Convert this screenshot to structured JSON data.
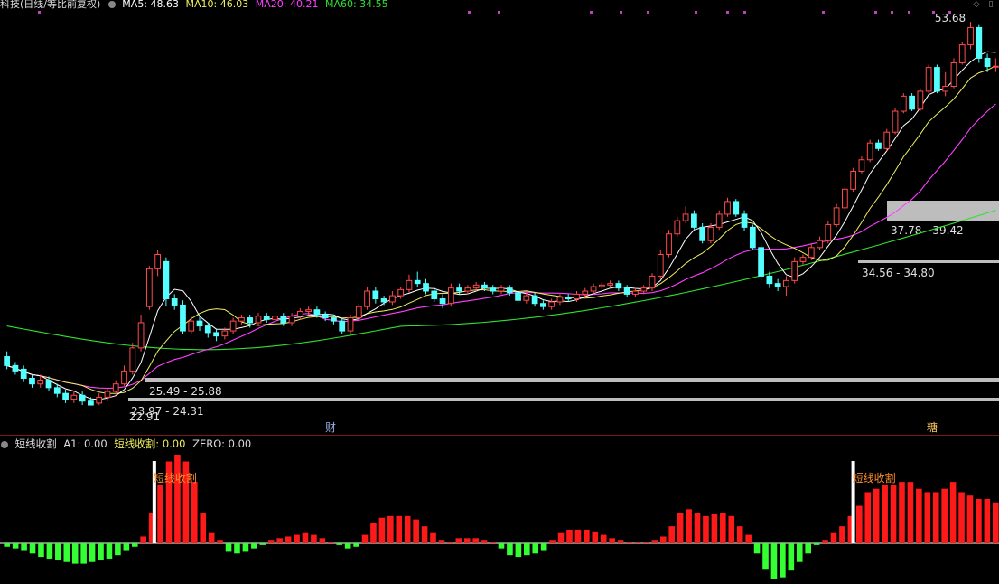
{
  "header": {
    "title": "科技(日线/等比前复权)",
    "ma5_label": "MA5: 48.63",
    "ma10_label": "MA10: 46.03",
    "ma20_label": "MA20: 40.21",
    "ma60_label": "MA60: 34.55"
  },
  "indicator_header": {
    "name": "短线收割",
    "a1_label": "A1: 0.00",
    "signal_label": "短线收割: 0.00",
    "zero_label": "ZERO: 0.00"
  },
  "markers": {
    "cai": "财",
    "tang": "糖"
  },
  "colors": {
    "up": "#ff4a4a",
    "down": "#54ffff",
    "ma5": "#ffffff",
    "ma10": "#f0f060",
    "ma20": "#ff40ff",
    "ma60": "#30e030",
    "pos_bar": "#ff1a1a",
    "neg_bar": "#33ff33",
    "signal_text": "#ff8c2a",
    "zone": "#bdbdbd"
  },
  "chart_data": [
    {
      "type": "candlestick",
      "title": "科技(日线/等比前复权)",
      "y_range": [
        22,
        55
      ],
      "high_label": "53.68",
      "low_label": "22.91",
      "zones": [
        {
          "label": "25.49 - 25.88",
          "low": 25.49,
          "high": 25.88
        },
        {
          "label": "23.97 - 24.31",
          "low": 23.97,
          "high": 24.31
        },
        {
          "label": "37.78 - 39.42",
          "low": 37.78,
          "high": 39.42
        },
        {
          "label": "34.56 - 34.80",
          "low": 34.56,
          "high": 34.8
        }
      ],
      "candles": [
        [
          25.5,
          25.0,
          25.8,
          24.8
        ],
        [
          25.0,
          24.7,
          25.2,
          24.5
        ],
        [
          24.8,
          24.3,
          25.0,
          24.1
        ],
        [
          24.3,
          24.0,
          24.5,
          23.8
        ],
        [
          24.0,
          24.2,
          24.5,
          23.8
        ],
        [
          24.2,
          23.8,
          24.4,
          23.6
        ],
        [
          23.8,
          23.5,
          24.0,
          23.3
        ],
        [
          23.5,
          23.2,
          23.7,
          23.0
        ],
        [
          23.2,
          23.4,
          23.6,
          23.0
        ],
        [
          23.4,
          23.1,
          23.6,
          22.9
        ],
        [
          23.1,
          22.9,
          23.3,
          22.91
        ],
        [
          23.0,
          23.3,
          23.5,
          22.9
        ],
        [
          23.3,
          23.6,
          23.8,
          23.1
        ],
        [
          23.6,
          24.0,
          24.2,
          23.4
        ],
        [
          24.0,
          24.7,
          25.0,
          23.9
        ],
        [
          24.7,
          26.0,
          26.3,
          24.5
        ],
        [
          26.0,
          27.5,
          28.0,
          25.8
        ],
        [
          28.5,
          31.0,
          31.2,
          28.3
        ],
        [
          31.0,
          32.0,
          32.3,
          30.5
        ],
        [
          31.5,
          29.0,
          31.8,
          28.5
        ],
        [
          29.0,
          28.6,
          29.3,
          28.3
        ],
        [
          28.6,
          27.0,
          28.9,
          26.8
        ],
        [
          27.0,
          27.6,
          27.9,
          26.8
        ],
        [
          27.6,
          27.3,
          27.9,
          27.0
        ],
        [
          27.3,
          26.9,
          27.5,
          26.6
        ],
        [
          26.9,
          26.7,
          27.1,
          26.4
        ],
        [
          26.7,
          27.0,
          27.2,
          26.5
        ],
        [
          27.0,
          27.6,
          27.8,
          26.8
        ],
        [
          27.6,
          27.8,
          28.0,
          27.4
        ],
        [
          27.8,
          27.5,
          28.0,
          27.2
        ],
        [
          27.5,
          27.9,
          28.1,
          27.3
        ],
        [
          27.9,
          27.7,
          28.1,
          27.5
        ],
        [
          27.7,
          27.9,
          28.1,
          27.5
        ],
        [
          27.9,
          27.5,
          28.1,
          27.3
        ],
        [
          27.5,
          27.9,
          28.1,
          27.3
        ],
        [
          27.9,
          28.2,
          28.4,
          27.7
        ],
        [
          28.2,
          28.3,
          28.5,
          28.0
        ],
        [
          28.3,
          28.0,
          28.5,
          27.8
        ],
        [
          28.0,
          27.8,
          28.2,
          27.6
        ],
        [
          27.8,
          27.6,
          28.0,
          27.4
        ],
        [
          27.6,
          27.0,
          27.8,
          26.8
        ],
        [
          27.0,
          27.8,
          28.0,
          26.8
        ],
        [
          27.8,
          28.5,
          28.7,
          27.6
        ],
        [
          28.5,
          29.5,
          29.8,
          28.3
        ],
        [
          29.5,
          29.0,
          29.8,
          28.7
        ],
        [
          29.0,
          28.8,
          29.2,
          28.6
        ],
        [
          28.8,
          29.2,
          29.5,
          28.6
        ],
        [
          29.2,
          29.6,
          29.8,
          29.0
        ],
        [
          29.6,
          30.2,
          30.6,
          29.4
        ],
        [
          30.2,
          30.0,
          30.8,
          29.8
        ],
        [
          30.0,
          29.5,
          30.3,
          29.3
        ],
        [
          29.5,
          29.0,
          29.8,
          28.8
        ],
        [
          29.0,
          28.7,
          29.3,
          28.4
        ],
        [
          28.7,
          29.7,
          30.0,
          28.5
        ],
        [
          29.7,
          29.5,
          30.0,
          29.3
        ],
        [
          29.5,
          29.7,
          29.9,
          29.3
        ],
        [
          29.7,
          29.9,
          30.1,
          29.5
        ],
        [
          29.9,
          29.7,
          30.1,
          29.5
        ],
        [
          29.7,
          29.5,
          29.9,
          29.3
        ],
        [
          29.5,
          29.7,
          29.9,
          29.3
        ],
        [
          29.7,
          29.4,
          29.9,
          29.2
        ],
        [
          29.4,
          28.9,
          29.6,
          28.7
        ],
        [
          28.9,
          29.2,
          29.4,
          28.7
        ],
        [
          29.2,
          28.7,
          29.4,
          28.5
        ],
        [
          28.7,
          28.5,
          28.9,
          28.3
        ],
        [
          28.5,
          28.8,
          29.0,
          28.3
        ],
        [
          28.8,
          29.1,
          29.3,
          28.6
        ],
        [
          29.1,
          29.0,
          29.3,
          28.8
        ],
        [
          29.0,
          29.3,
          29.5,
          28.8
        ],
        [
          29.3,
          29.5,
          29.7,
          29.1
        ],
        [
          29.5,
          29.8,
          30.0,
          29.3
        ],
        [
          29.8,
          29.9,
          30.1,
          29.6
        ],
        [
          29.9,
          30.0,
          30.2,
          29.7
        ],
        [
          30.0,
          29.7,
          30.2,
          29.5
        ],
        [
          29.7,
          29.3,
          29.9,
          29.1
        ],
        [
          29.3,
          29.5,
          29.7,
          29.1
        ],
        [
          29.5,
          29.7,
          29.9,
          29.3
        ],
        [
          29.7,
          30.5,
          30.7,
          29.5
        ],
        [
          30.5,
          32.0,
          32.3,
          30.3
        ],
        [
          32.0,
          33.5,
          33.8,
          31.8
        ],
        [
          33.5,
          34.5,
          34.8,
          33.3
        ],
        [
          34.5,
          35.0,
          35.6,
          34.3
        ],
        [
          35.0,
          34.0,
          35.3,
          33.8
        ],
        [
          34.0,
          33.0,
          34.3,
          32.8
        ],
        [
          33.0,
          34.0,
          34.3,
          32.8
        ],
        [
          34.0,
          35.0,
          35.3,
          33.8
        ],
        [
          35.0,
          36.0,
          36.3,
          34.8
        ],
        [
          36.0,
          35.0,
          36.2,
          34.8
        ],
        [
          35.0,
          34.0,
          35.3,
          33.7
        ],
        [
          34.0,
          32.5,
          34.2,
          32.3
        ],
        [
          32.5,
          30.5,
          32.8,
          30.2
        ],
        [
          30.5,
          30.0,
          30.8,
          29.7
        ],
        [
          30.0,
          29.8,
          30.3,
          29.5
        ],
        [
          29.8,
          30.2,
          30.5,
          29.2
        ],
        [
          30.2,
          31.5,
          31.8,
          30.0
        ],
        [
          31.5,
          31.8,
          32.0,
          31.3
        ],
        [
          31.8,
          32.5,
          32.8,
          31.6
        ],
        [
          32.5,
          33.0,
          33.3,
          32.3
        ],
        [
          33.0,
          34.2,
          34.5,
          32.8
        ],
        [
          34.2,
          35.5,
          35.8,
          34.0
        ],
        [
          35.5,
          37.0,
          37.2,
          35.3
        ],
        [
          37.0,
          38.5,
          38.8,
          36.8
        ],
        [
          38.5,
          39.5,
          39.8,
          38.3
        ],
        [
          39.5,
          41.0,
          41.3,
          39.3
        ],
        [
          41.0,
          40.5,
          41.3,
          40.3
        ],
        [
          40.5,
          42.0,
          42.3,
          40.3
        ],
        [
          42.0,
          44.0,
          44.3,
          41.8
        ],
        [
          44.0,
          45.5,
          45.8,
          43.8
        ],
        [
          45.5,
          44.2,
          45.8,
          44.0
        ],
        [
          44.2,
          46.0,
          46.3,
          44.0
        ],
        [
          46.0,
          48.5,
          48.8,
          45.8
        ],
        [
          48.5,
          46.0,
          48.8,
          45.8
        ],
        [
          46.0,
          46.5,
          48.0,
          45.5
        ],
        [
          46.5,
          49.0,
          49.5,
          46.3
        ],
        [
          49.0,
          51.0,
          51.3,
          48.8
        ],
        [
          51.0,
          53.0,
          53.68,
          50.5
        ],
        [
          53.0,
          49.5,
          53.3,
          49.0
        ],
        [
          49.5,
          48.6,
          50.0,
          48.0
        ],
        [
          48.6,
          48.63,
          49.5,
          48.0
        ]
      ]
    },
    {
      "type": "bar",
      "title": "短线收割",
      "y_range": [
        -1.5,
        3.5
      ],
      "values": [
        -0.1,
        -0.15,
        -0.2,
        -0.3,
        -0.4,
        -0.45,
        -0.5,
        -0.55,
        -0.6,
        -0.6,
        -0.55,
        -0.5,
        -0.45,
        -0.35,
        -0.2,
        -0.1,
        0.2,
        0.9,
        1.7,
        2.4,
        2.6,
        2.4,
        1.8,
        0.9,
        0.3,
        0.1,
        -0.25,
        -0.3,
        -0.25,
        -0.15,
        -0.05,
        0.1,
        0.15,
        0.2,
        0.25,
        0.3,
        0.25,
        0.15,
        0.05,
        -0.05,
        -0.15,
        -0.1,
        0.25,
        0.6,
        0.75,
        0.8,
        0.8,
        0.8,
        0.7,
        0.5,
        0.3,
        0.1,
        0.05,
        0.15,
        0.15,
        0.15,
        0.1,
        0.05,
        -0.15,
        -0.35,
        -0.4,
        -0.35,
        -0.3,
        -0.2,
        0.1,
        0.3,
        0.4,
        0.4,
        0.4,
        0.35,
        0.25,
        0.15,
        0.1,
        0.05,
        0.05,
        0.05,
        0.1,
        0.2,
        0.5,
        0.9,
        1.0,
        0.9,
        0.8,
        0.85,
        0.9,
        0.8,
        0.5,
        0.25,
        -0.3,
        -0.75,
        -1.05,
        -1.0,
        -0.8,
        -0.55,
        -0.3,
        -0.05,
        0.1,
        0.3,
        0.5,
        0.8,
        1.1,
        1.5,
        1.6,
        1.7,
        1.7,
        1.8,
        1.8,
        1.6,
        1.5,
        1.5,
        1.6,
        1.8,
        1.5,
        1.4,
        1.3,
        1.3,
        1.2
      ],
      "signals": [
        {
          "label": "短线收割",
          "index": 18
        },
        {
          "label": "短线收割",
          "index": 100
        }
      ]
    }
  ]
}
